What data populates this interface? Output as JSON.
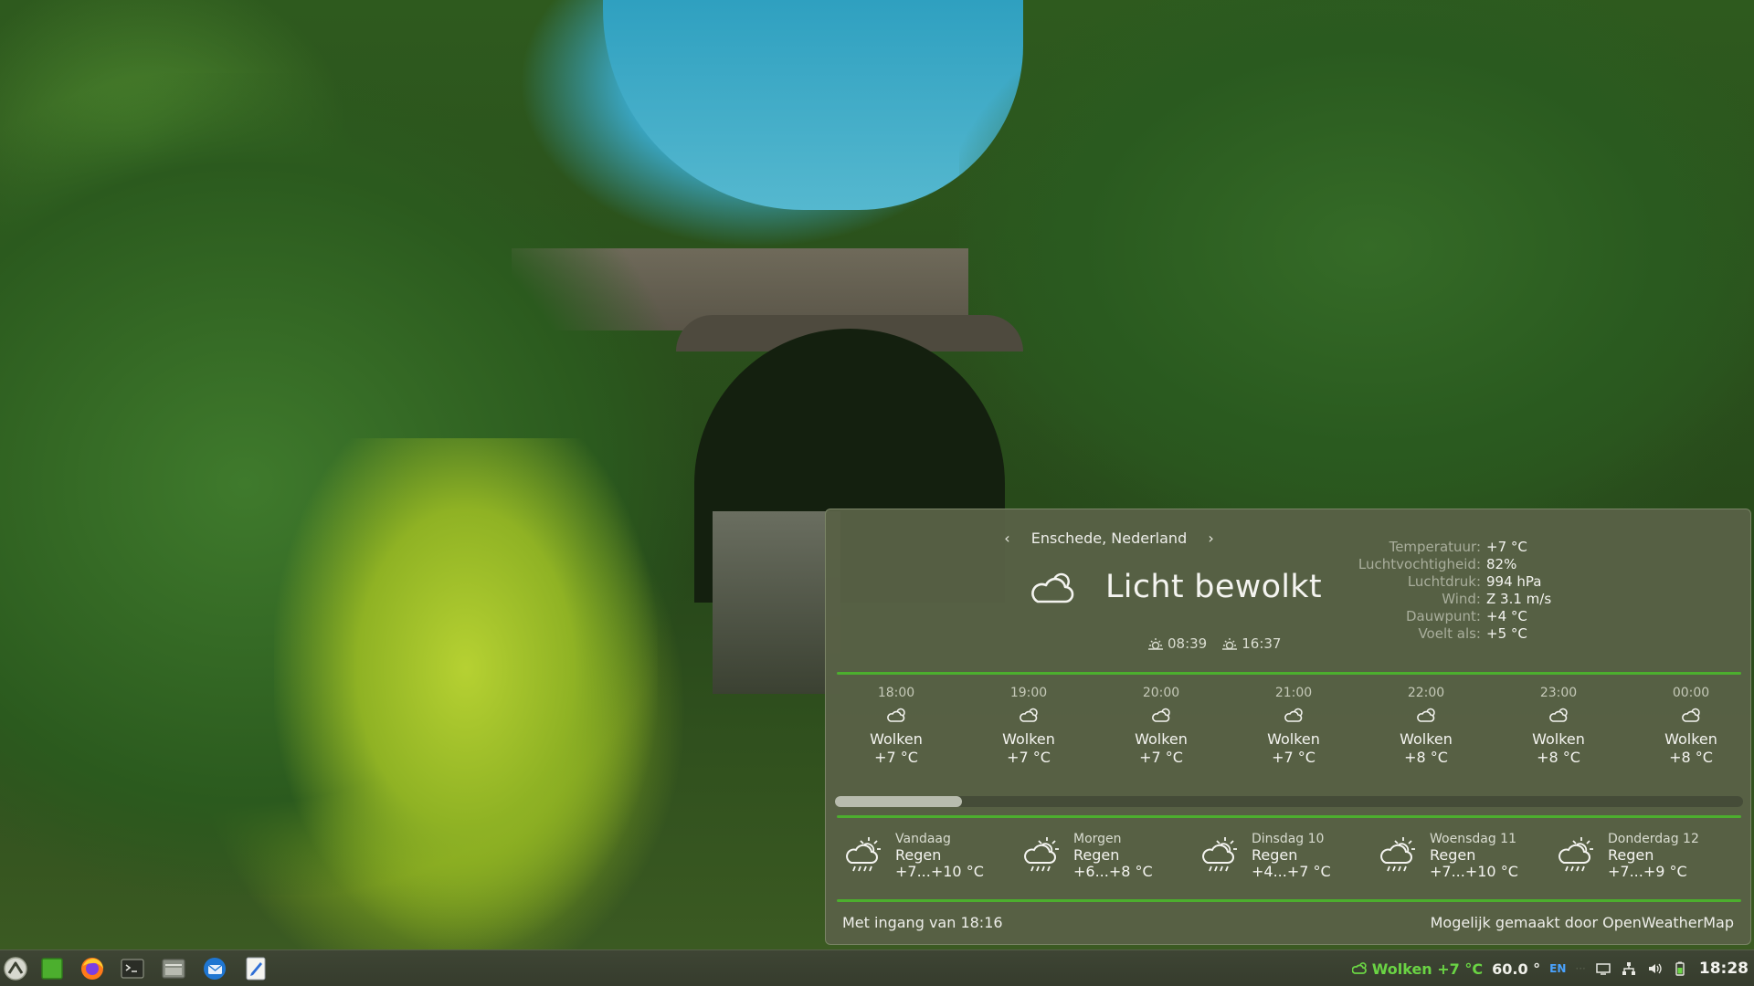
{
  "weather": {
    "location": "Enschede, Nederland",
    "prev_label": "‹",
    "next_label": "›",
    "condition": "Licht bewolkt",
    "sunrise": "08:39",
    "sunset": "16:37",
    "details": [
      {
        "key": "Temperatuur:",
        "value": "+7 °C"
      },
      {
        "key": "Luchtvochtigheid:",
        "value": "82%"
      },
      {
        "key": "Luchtdruk:",
        "value": "994 hPa"
      },
      {
        "key": "Wind:",
        "value": "Z 3.1 m/s"
      },
      {
        "key": "Dauwpunt:",
        "value": "+4 °C"
      },
      {
        "key": "Voelt als:",
        "value": "+5 °C"
      }
    ],
    "hourly": [
      {
        "time": "18:00",
        "cond": "Wolken",
        "temp": "+7 °C"
      },
      {
        "time": "19:00",
        "cond": "Wolken",
        "temp": "+7 °C"
      },
      {
        "time": "20:00",
        "cond": "Wolken",
        "temp": "+7 °C"
      },
      {
        "time": "21:00",
        "cond": "Wolken",
        "temp": "+7 °C"
      },
      {
        "time": "22:00",
        "cond": "Wolken",
        "temp": "+8 °C"
      },
      {
        "time": "23:00",
        "cond": "Wolken",
        "temp": "+8 °C"
      },
      {
        "time": "00:00",
        "cond": "Wolken",
        "temp": "+8 °C"
      }
    ],
    "hourly_scroll_fraction": 0.14,
    "daily": [
      {
        "name": "Vandaag",
        "cond": "Regen",
        "temp": "+7...+10 °C"
      },
      {
        "name": "Morgen",
        "cond": "Regen",
        "temp": "+6...+8 °C"
      },
      {
        "name": "Dinsdag 10",
        "cond": "Regen",
        "temp": "+4...+7 °C"
      },
      {
        "name": "Woensdag 11",
        "cond": "Regen",
        "temp": "+7...+10 °C"
      },
      {
        "name": "Donderdag 12",
        "cond": "Regen",
        "temp": "+7...+9 °C"
      }
    ],
    "footer_left": "Met ingang van 18:16",
    "footer_right": "Mogelijk gemaakt door OpenWeatherMap",
    "accent_color": "#4caf2e"
  },
  "panel": {
    "launchers": [
      {
        "name": "menu",
        "icon": "menu-logo-icon"
      },
      {
        "name": "show-desktop",
        "icon": "desktop-icon"
      },
      {
        "name": "firefox",
        "icon": "firefox-icon"
      },
      {
        "name": "terminal",
        "icon": "terminal-icon"
      },
      {
        "name": "files",
        "icon": "folder-icon"
      },
      {
        "name": "thunderbird",
        "icon": "mail-icon"
      },
      {
        "name": "text-editor",
        "icon": "text-editor-icon"
      }
    ],
    "tray": {
      "weather": "Wolken +7 °C",
      "temp": "60.0 °",
      "lang": "EN",
      "clock": "18:28"
    },
    "weather_color": "#6ad444",
    "lang_color": "#4aa3ff"
  }
}
